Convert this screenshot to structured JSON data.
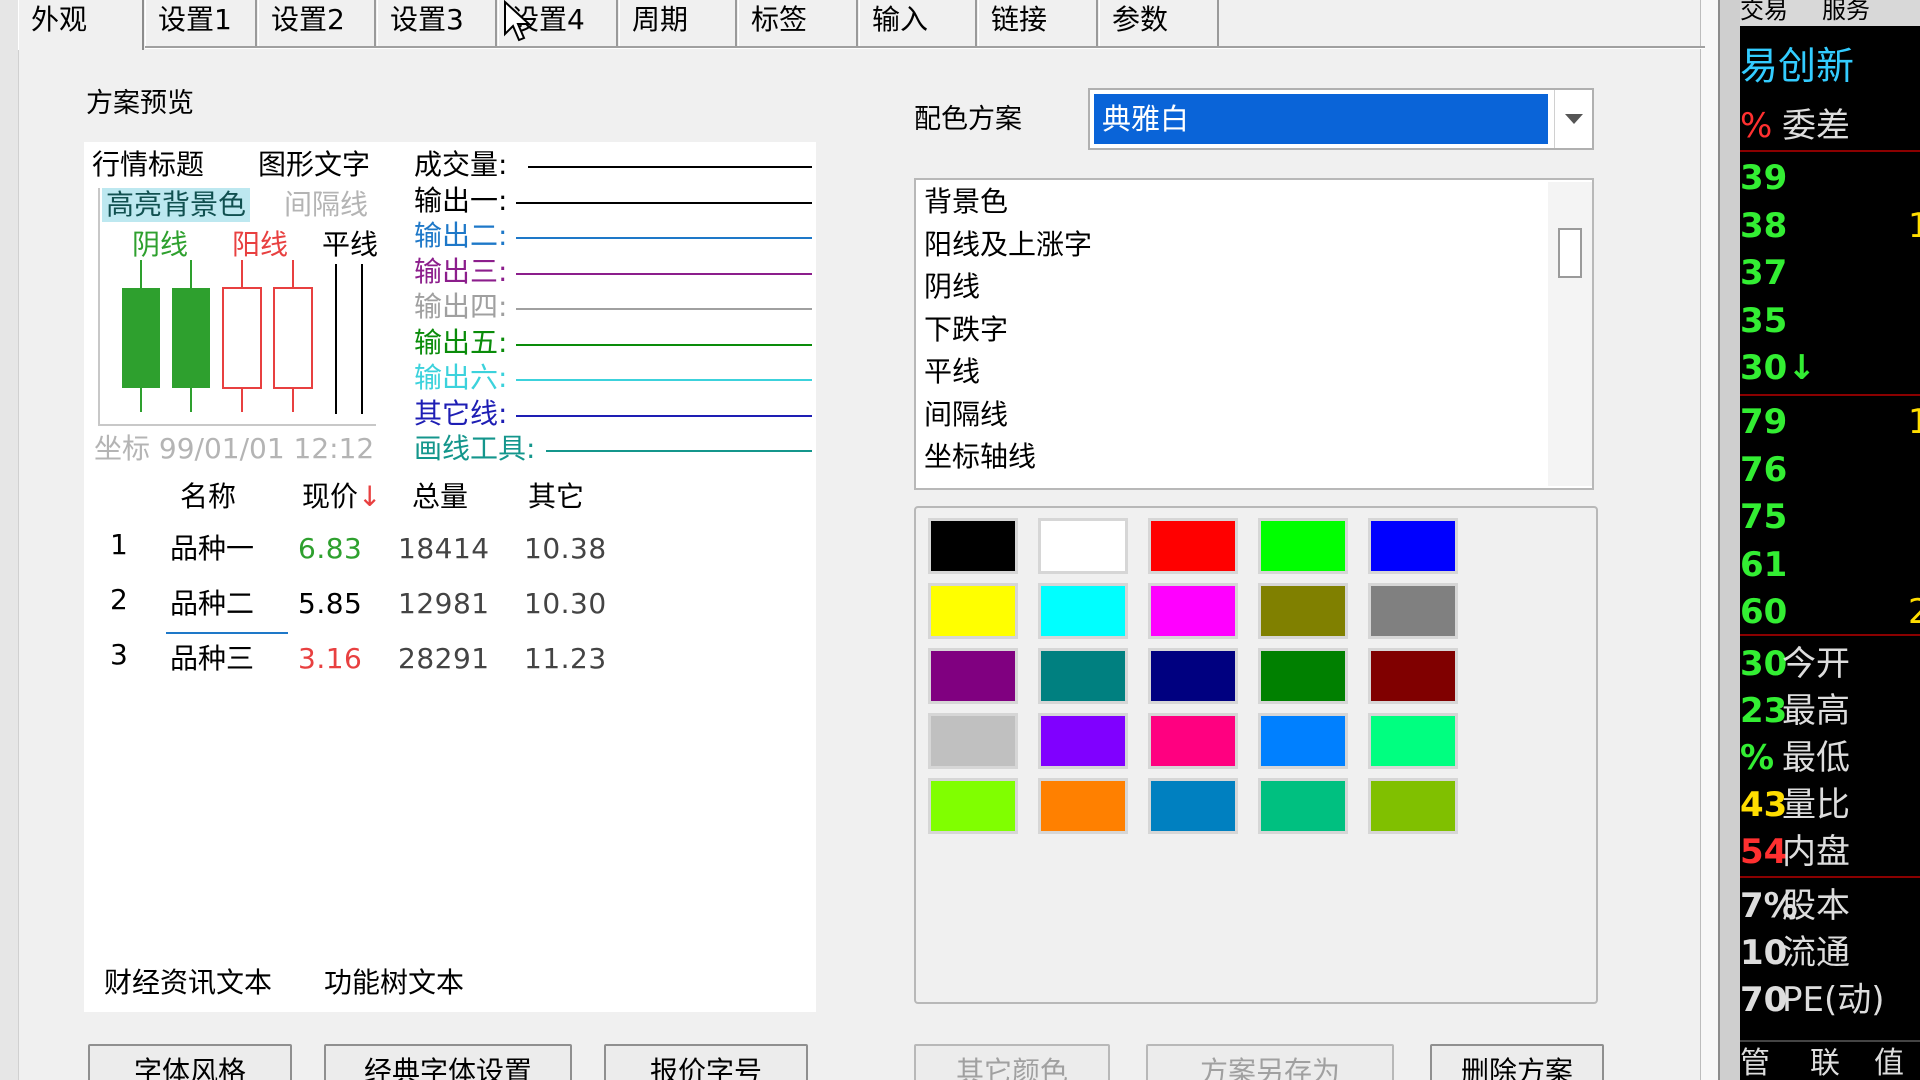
{
  "tabs": [
    {
      "label": "外观",
      "active": true
    },
    {
      "label": "设置1"
    },
    {
      "label": "设置2"
    },
    {
      "label": "设置3"
    },
    {
      "label": "设置4"
    },
    {
      "label": "周期"
    },
    {
      "label": "标签"
    },
    {
      "label": "输入"
    },
    {
      "label": "链接"
    },
    {
      "label": "参数"
    }
  ],
  "preview": {
    "section_label": "方案预览",
    "header_title": "行情标题",
    "graphic_text": "图形文字",
    "highlight_bg": "高亮背景色",
    "divider_line": "间隔线",
    "yin_line": "阴线",
    "yang_line": "阳线",
    "flat_line": "平线",
    "coord": "坐标 99/01/01 12:12",
    "lines": [
      {
        "label": "成交量:",
        "color": "#000000"
      },
      {
        "label": "输出一:",
        "color": "#000000"
      },
      {
        "label": "输出二:",
        "color": "#1e78c8"
      },
      {
        "label": "输出三:",
        "color": "#8c1e8c"
      },
      {
        "label": "输出四:",
        "color": "#a0a0a0"
      },
      {
        "label": "输出五:",
        "color": "#0a8c0a"
      },
      {
        "label": "输出六:",
        "color": "#3cd2dc"
      },
      {
        "label": "其它线:",
        "color": "#1e1eb4"
      },
      {
        "label": "画线工具:",
        "color": "#14968c"
      }
    ],
    "table": {
      "headers": [
        "名称",
        "现价",
        "总量",
        "其它"
      ],
      "sort_arrow": "↓",
      "rows": [
        {
          "idx": "1",
          "name": "品种一",
          "price": "6.83",
          "volume": "18414",
          "other": "10.38",
          "price_color": "#2ea02e"
        },
        {
          "idx": "2",
          "name": "品种二",
          "price": "5.85",
          "volume": "12981",
          "other": "10.30",
          "price_color": "#000000"
        },
        {
          "idx": "3",
          "name": "品种三",
          "price": "3.16",
          "volume": "28291",
          "other": "11.23",
          "price_color": "#e84040"
        }
      ]
    },
    "finance_text": "财经资讯文本",
    "tree_text": "功能树文本"
  },
  "scheme": {
    "label": "配色方案",
    "selected": "典雅白"
  },
  "color_items": [
    "背景色",
    "阳线及上涨字",
    "阴线",
    "下跌字",
    "平线",
    "间隔线",
    "坐标轴线"
  ],
  "palette": [
    "#000000",
    "#ffffff",
    "#ff0000",
    "#00ff00",
    "#0000ff",
    "#ffff00",
    "#00ffff",
    "#ff00ff",
    "#808000",
    "#808080",
    "#800080",
    "#008080",
    "#000080",
    "#008000",
    "#800000",
    "#c0c0c0",
    "#8000ff",
    "#ff0080",
    "#0080ff",
    "#00ff80",
    "#80ff00",
    "#ff8000",
    "#0080c0",
    "#00c080",
    "#80c000"
  ],
  "buttons": {
    "font_style": "字体风格",
    "classic_font": "经典字体设置",
    "quote_font": "报价字号",
    "other_color": "其它颜色",
    "scheme_save": "方案另存为",
    "delete_scheme": "删除方案"
  },
  "ticker": {
    "top_tabs": [
      "交易",
      "服务"
    ],
    "title": "易创新",
    "row_pct": "%",
    "row_label": "委差",
    "prices": [
      {
        "v": "39",
        "c": "#33ee33",
        "extra": ""
      },
      {
        "v": "38",
        "c": "#33ee33",
        "extra": "1"
      },
      {
        "v": "37",
        "c": "#33ee33",
        "extra": ""
      },
      {
        "v": "35",
        "c": "#33ee33",
        "extra": ""
      },
      {
        "v": "30↓",
        "c": "#33ee33",
        "extra": ""
      },
      {
        "v": "79",
        "c": "#33ee33",
        "extra": "1"
      },
      {
        "v": "76",
        "c": "#33ee33",
        "extra": ""
      },
      {
        "v": "75",
        "c": "#33ee33",
        "extra": ""
      },
      {
        "v": "61",
        "c": "#33ee33",
        "extra": ""
      },
      {
        "v": "60",
        "c": "#33ee33",
        "extra": "2"
      }
    ],
    "stats": [
      {
        "v": "30",
        "c": "#33ee33",
        "label": "今开"
      },
      {
        "v": "23",
        "c": "#33ee33",
        "label": "最高"
      },
      {
        "v": "%",
        "c": "#33ee33",
        "label": "最低"
      },
      {
        "v": "43",
        "c": "#ffdd00",
        "label": "量比"
      },
      {
        "v": "54",
        "c": "#ff3030",
        "label": "内盘"
      }
    ],
    "stats2": [
      {
        "v": "7%",
        "label": "股本"
      },
      {
        "v": "10",
        "label": "流通"
      },
      {
        "v": "70",
        "label": "PE(动)"
      }
    ],
    "bottom": [
      "管",
      "联",
      "值"
    ]
  }
}
